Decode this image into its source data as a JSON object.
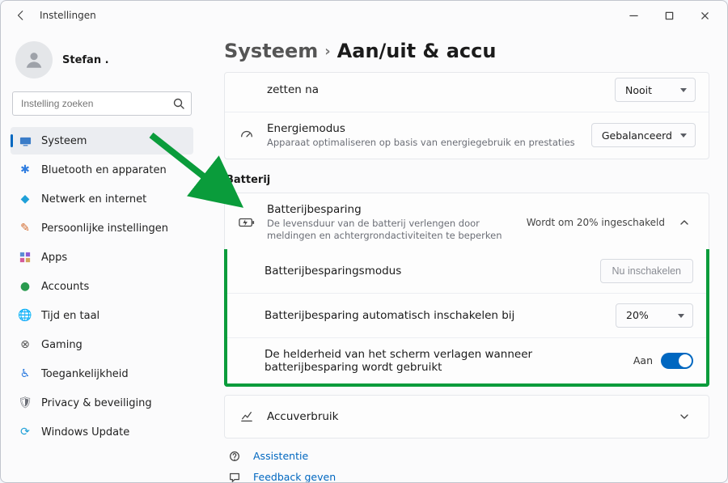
{
  "titlebar": {
    "title": "Instellingen"
  },
  "user": {
    "name": "Stefan ."
  },
  "search": {
    "placeholder": "Instelling zoeken"
  },
  "sidebar": {
    "items": [
      {
        "label": "Systeem"
      },
      {
        "label": "Bluetooth en apparaten"
      },
      {
        "label": "Netwerk en internet"
      },
      {
        "label": "Persoonlijke instellingen"
      },
      {
        "label": "Apps"
      },
      {
        "label": "Accounts"
      },
      {
        "label": "Tijd en taal"
      },
      {
        "label": "Gaming"
      },
      {
        "label": "Toegankelijkheid"
      },
      {
        "label": "Privacy & beveiliging"
      },
      {
        "label": "Windows Update"
      }
    ]
  },
  "breadcrumb": {
    "parent": "Systeem",
    "current": "Aan/uit & accu"
  },
  "power": {
    "sleep_row_tail": "zetten na",
    "sleep_value": "Nooit",
    "energy_title": "Energiemodus",
    "energy_sub": "Apparaat optimaliseren op basis van energiegebruik en prestaties",
    "energy_value": "Gebalanceerd"
  },
  "battery": {
    "section": "Batterij",
    "saver_title": "Batterijbesparing",
    "saver_sub": "De levensduur van de batterij verlengen door meldingen en achtergrondactiviteiten te beperken",
    "saver_status": "Wordt om 20% ingeschakeld",
    "mode_label": "Batterijbesparingsmodus",
    "mode_btn": "Nu inschakelen",
    "auto_label": "Batterijbesparing automatisch inschakelen bij",
    "auto_value": "20%",
    "brightness_label": "De helderheid van het scherm verlagen wanneer batterijbesparing wordt gebruikt",
    "brightness_toggle": "Aan",
    "usage_label": "Accuverbruik"
  },
  "footer": {
    "help": "Assistentie",
    "feedback": "Feedback geven"
  }
}
